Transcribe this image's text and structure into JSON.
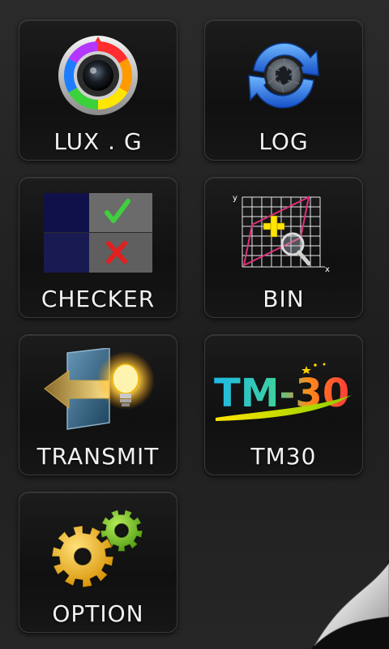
{
  "tiles": [
    {
      "label": "LUX . G",
      "icon": "color-wheel-camera-icon"
    },
    {
      "label": "LOG",
      "icon": "sync-camera-icon"
    },
    {
      "label": "CHECKER",
      "icon": "checker-icon"
    },
    {
      "label": "BIN",
      "icon": "bin-chart-icon"
    },
    {
      "label": "TRANSMIT",
      "icon": "transmit-bulb-icon"
    },
    {
      "label": "TM30",
      "icon": "tm30-logo-icon"
    },
    {
      "label": "OPTION",
      "icon": "gears-icon"
    }
  ],
  "bin_icon": {
    "y_axis": "y",
    "x_axis": "x"
  },
  "tm30_logo_text": "TM-30",
  "colors": {
    "check": "#3fcf3f",
    "cross": "#e02020",
    "gear_yellow": "#f2b418",
    "gear_green": "#79c51f",
    "bin_outline": "#e0307a"
  }
}
